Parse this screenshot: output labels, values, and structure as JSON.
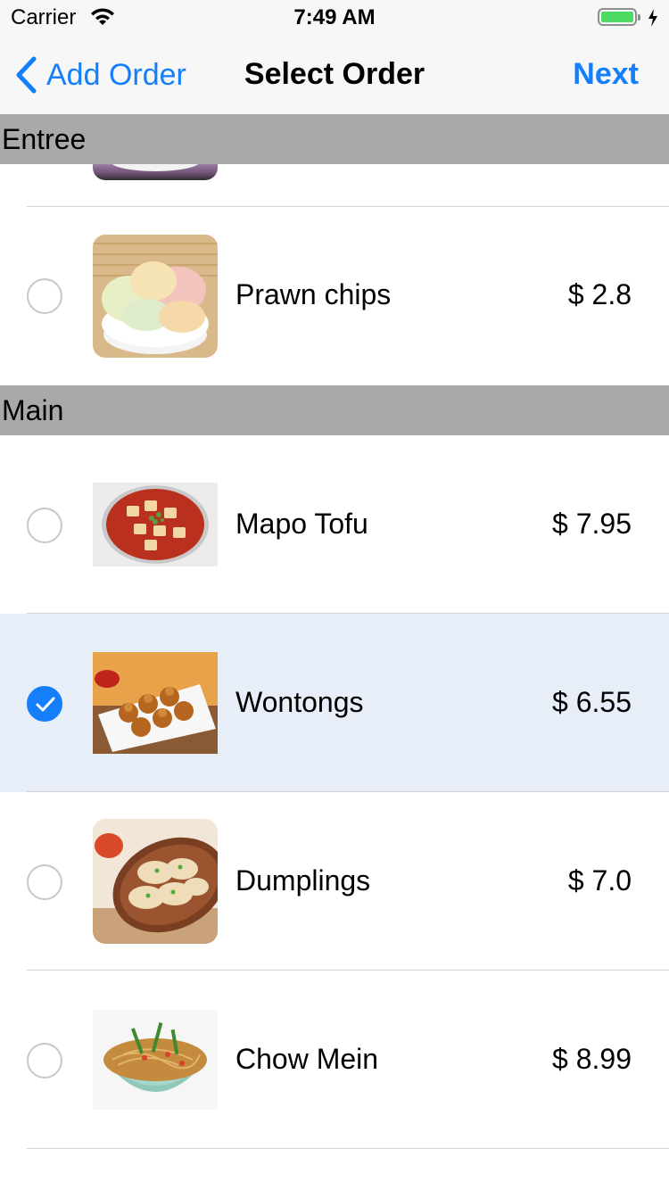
{
  "status_bar": {
    "carrier": "Carrier",
    "time": "7:49 AM"
  },
  "nav": {
    "back_label": "Add Order",
    "title": "Select Order",
    "next_label": "Next"
  },
  "sections": {
    "entree": {
      "title": "Entree"
    },
    "main": {
      "title": "Main"
    }
  },
  "items": [
    {
      "name": "Prawn chips",
      "price": "$ 2.8",
      "selected": false
    },
    {
      "name": "Mapo Tofu",
      "price": "$ 7.95",
      "selected": false
    },
    {
      "name": "Wontongs",
      "price": "$ 6.55",
      "selected": true
    },
    {
      "name": "Dumplings",
      "price": "$ 7.0",
      "selected": false
    },
    {
      "name": "Chow Mein",
      "price": "$ 8.99",
      "selected": false
    }
  ],
  "colors": {
    "accent": "#147efb",
    "section_header": "#a9a9a9",
    "selected_row": "#e8eef8",
    "battery": "#4cd964"
  }
}
